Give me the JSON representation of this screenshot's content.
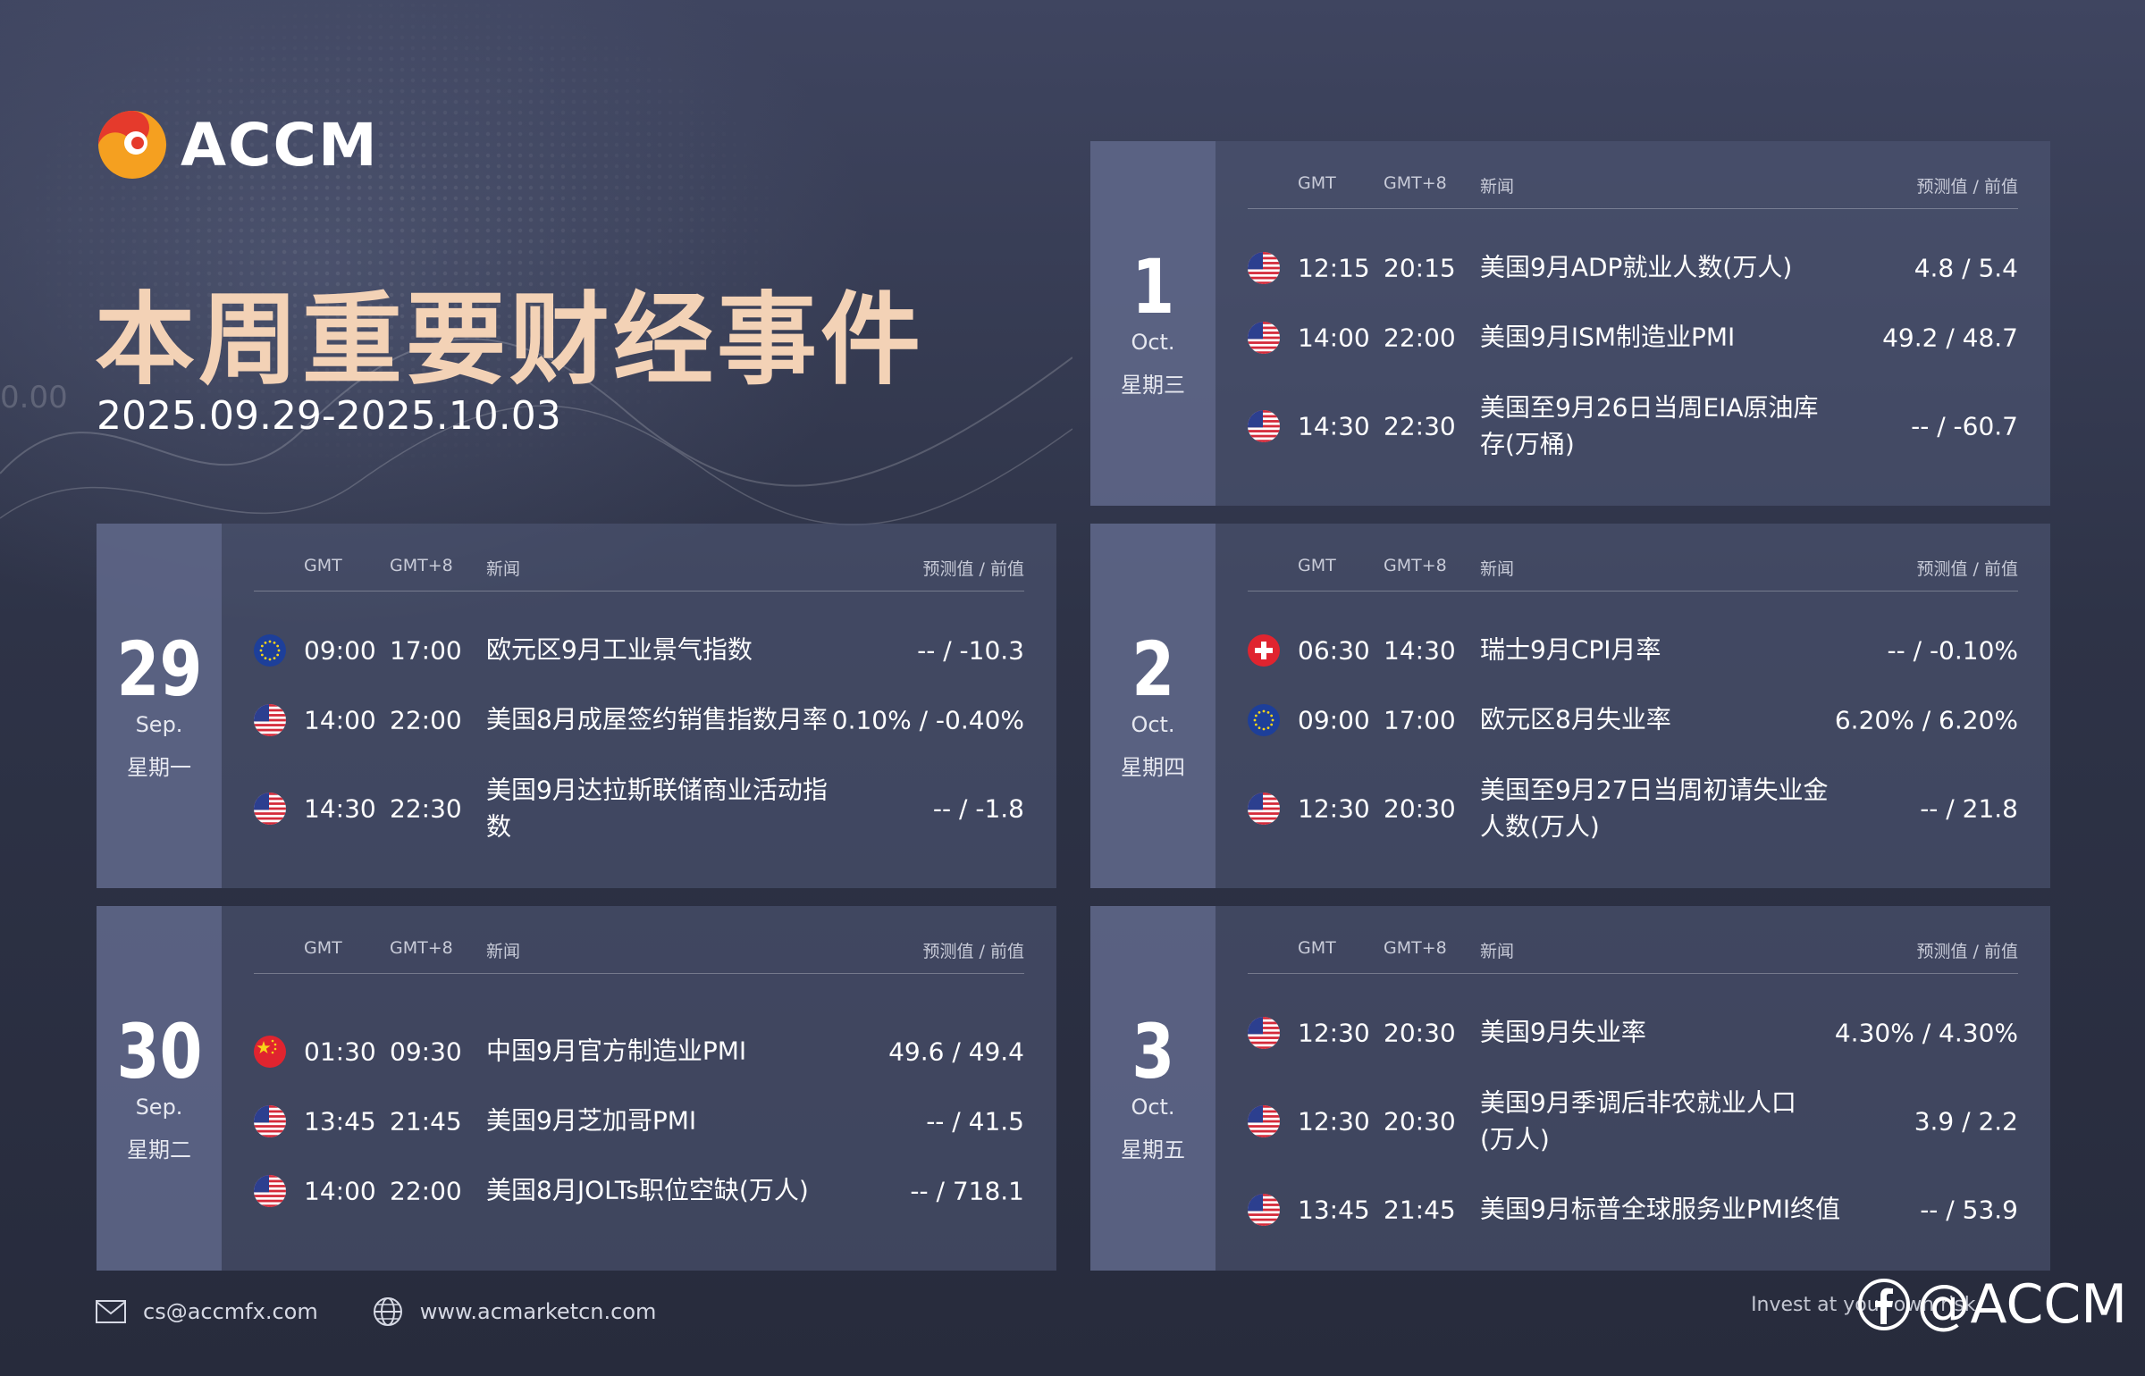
{
  "logo": {
    "text": "ACCM"
  },
  "title": "本周重要财经事件",
  "date_range": "2025.09.29-2025.10.03",
  "bg_number": "0.00",
  "table_headers": {
    "gmt": "GMT",
    "gmt8": "GMT+8",
    "news": "新闻",
    "values": "预测值 / 前值"
  },
  "colors": {
    "title": "#f3d2b6",
    "card_bg": "#4e5572",
    "day_bg": "#626a8c",
    "logo_orange": "#f5a020",
    "logo_red": "#e53a2c"
  },
  "days": [
    {
      "id": "oct1",
      "day": "1",
      "month": "Oct.",
      "weekday": "星期三",
      "events": [
        {
          "flag": "us",
          "gmt": "12:15",
          "gmt8": "20:15",
          "news": "美国9月ADP就业人数(万人)",
          "values": "4.8 / 5.4"
        },
        {
          "flag": "us",
          "gmt": "14:00",
          "gmt8": "22:00",
          "news": "美国9月ISM制造业PMI",
          "values": "49.2 / 48.7"
        },
        {
          "flag": "us",
          "gmt": "14:30",
          "gmt8": "22:30",
          "news": "美国至9月26日当周EIA原油库存(万桶)",
          "values": "-- / -60.7"
        }
      ]
    },
    {
      "id": "sep29",
      "day": "29",
      "month": "Sep.",
      "weekday": "星期一",
      "events": [
        {
          "flag": "eu",
          "gmt": "09:00",
          "gmt8": "17:00",
          "news": "欧元区9月工业景气指数",
          "values": "-- / -10.3"
        },
        {
          "flag": "us",
          "gmt": "14:00",
          "gmt8": "22:00",
          "news": "美国8月成屋签约销售指数月率",
          "values": "0.10% / -0.40%"
        },
        {
          "flag": "us",
          "gmt": "14:30",
          "gmt8": "22:30",
          "news": "美国9月达拉斯联储商业活动指数",
          "values": "-- / -1.8"
        }
      ]
    },
    {
      "id": "oct2",
      "day": "2",
      "month": "Oct.",
      "weekday": "星期四",
      "events": [
        {
          "flag": "ch",
          "gmt": "06:30",
          "gmt8": "14:30",
          "news": "瑞士9月CPI月率",
          "values": "-- / -0.10%"
        },
        {
          "flag": "eu",
          "gmt": "09:00",
          "gmt8": "17:00",
          "news": "欧元区8月失业率",
          "values": "6.20% / 6.20%"
        },
        {
          "flag": "us",
          "gmt": "12:30",
          "gmt8": "20:30",
          "news": "美国至9月27日当周初请失业金人数(万人)",
          "values": "-- / 21.8"
        }
      ]
    },
    {
      "id": "sep30",
      "day": "30",
      "month": "Sep.",
      "weekday": "星期二",
      "events": [
        {
          "flag": "cn",
          "gmt": "01:30",
          "gmt8": "09:30",
          "news": "中国9月官方制造业PMI",
          "values": "49.6 / 49.4"
        },
        {
          "flag": "us",
          "gmt": "13:45",
          "gmt8": "21:45",
          "news": "美国9月芝加哥PMI",
          "values": "-- / 41.5"
        },
        {
          "flag": "us",
          "gmt": "14:00",
          "gmt8": "22:00",
          "news": "美国8月JOLTs职位空缺(万人)",
          "values": "-- / 718.1"
        }
      ]
    },
    {
      "id": "oct3",
      "day": "3",
      "month": "Oct.",
      "weekday": "星期五",
      "events": [
        {
          "flag": "us",
          "gmt": "12:30",
          "gmt8": "20:30",
          "news": "美国9月失业率",
          "values": "4.30% / 4.30%"
        },
        {
          "flag": "us",
          "gmt": "12:30",
          "gmt8": "20:30",
          "news": "美国9月季调后非农就业人口(万人)",
          "values": "3.9 / 2.2"
        },
        {
          "flag": "us",
          "gmt": "13:45",
          "gmt8": "21:45",
          "news": "美国9月标普全球服务业PMI终值",
          "values": "-- / 53.9"
        }
      ]
    }
  ],
  "footer": {
    "email": "cs@accmfx.com",
    "website": "www.acmarketcn.com",
    "disclaimer": "Invest at your own risk",
    "social_handle": "@ACCM",
    "email_icon": "mail-icon",
    "web_icon": "globe-icon",
    "social_icon": "facebook-icon"
  }
}
